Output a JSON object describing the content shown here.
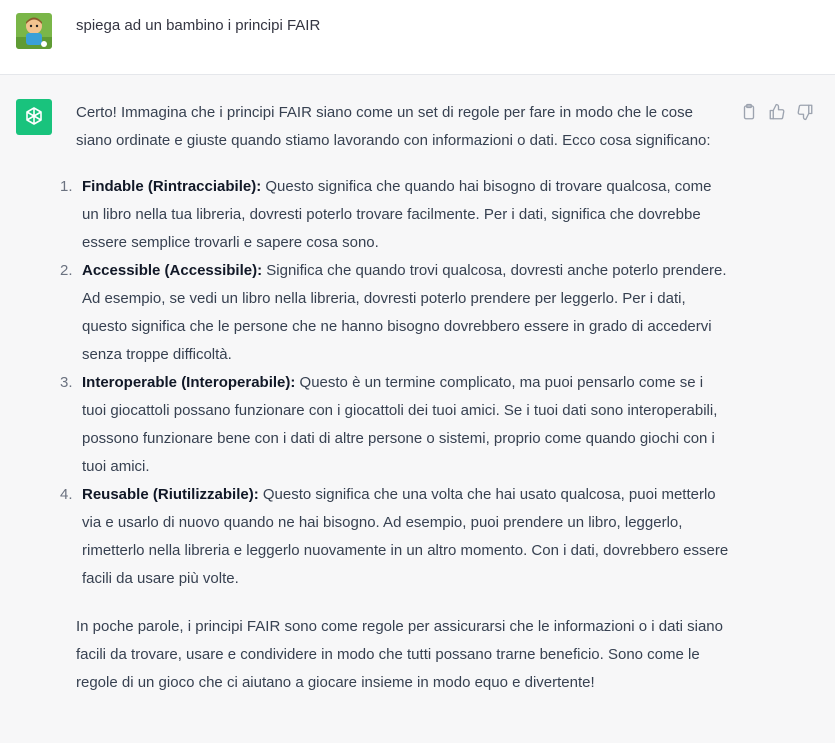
{
  "user_message": {
    "avatar_icon": "user-avatar-cartoon-boy",
    "text": "spiega ad un bambino i principi FAIR"
  },
  "assistant_message": {
    "avatar_icon": "openai-logo-icon",
    "intro": "Certo! Immagina che i principi FAIR siano come un set di regole per fare in modo che le cose siano ordinate e giuste quando stiamo lavorando con informazioni o dati. Ecco cosa significano:",
    "items": [
      {
        "num": "1.",
        "title": "Findable (Rintracciabile):",
        "text": " Questo significa che quando hai bisogno di trovare qualcosa, come un libro nella tua libreria, dovresti poterlo trovare facilmente. Per i dati, significa che dovrebbe essere semplice trovarli e sapere cosa sono."
      },
      {
        "num": "2.",
        "title": "Accessible (Accessibile):",
        "text": " Significa che quando trovi qualcosa, dovresti anche poterlo prendere. Ad esempio, se vedi un libro nella libreria, dovresti poterlo prendere per leggerlo. Per i dati, questo significa che le persone che ne hanno bisogno dovrebbero essere in grado di accedervi senza troppe difficoltà."
      },
      {
        "num": "3.",
        "title": "Interoperable (Interoperabile):",
        "text": " Questo è un termine complicato, ma puoi pensarlo come se i tuoi giocattoli possano funzionare con i giocattoli dei tuoi amici. Se i tuoi dati sono interoperabili, possono funzionare bene con i dati di altre persone o sistemi, proprio come quando giochi con i tuoi amici."
      },
      {
        "num": "4.",
        "title": "Reusable (Riutilizzabile):",
        "text": " Questo significa che una volta che hai usato qualcosa, puoi metterlo via e usarlo di nuovo quando ne hai bisogno. Ad esempio, puoi prendere un libro, leggerlo, rimetterlo nella libreria e leggerlo nuovamente in un altro momento. Con i dati, dovrebbero essere facili da usare più volte."
      }
    ],
    "conclusion": "In poche parole, i principi FAIR sono come regole per assicurarsi che le informazioni o i dati siano facili da trovare, usare e condividere in modo che tutti possano trarne beneficio. Sono come le regole di un gioco che ci aiutano a giocare insieme in modo equo e divertente!"
  },
  "actions": {
    "copy_icon": "clipboard-icon",
    "like_icon": "thumbs-up-icon",
    "dislike_icon": "thumbs-down-icon"
  },
  "colors": {
    "assistant_bg": "#f7f7f8",
    "bot_avatar": "#19c37d"
  }
}
